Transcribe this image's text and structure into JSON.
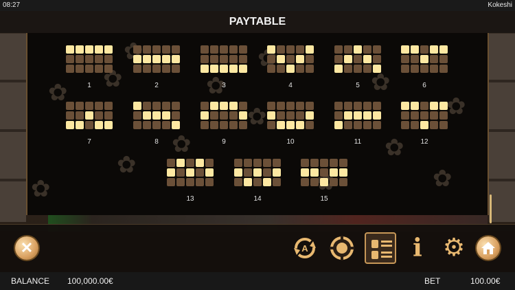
{
  "status": {
    "time": "08:27",
    "game_name": "Kokeshi"
  },
  "paytable": {
    "title": "PAYTABLE",
    "lines": [
      {
        "number": "1",
        "rows": [
          [
            1,
            1,
            1,
            1,
            1
          ],
          [
            0,
            0,
            0,
            0,
            0
          ],
          [
            0,
            0,
            0,
            0,
            0
          ]
        ]
      },
      {
        "number": "2",
        "rows": [
          [
            0,
            0,
            0,
            0,
            0
          ],
          [
            1,
            1,
            1,
            1,
            1
          ],
          [
            0,
            0,
            0,
            0,
            0
          ]
        ]
      },
      {
        "number": "3",
        "rows": [
          [
            0,
            0,
            0,
            0,
            0
          ],
          [
            0,
            0,
            0,
            0,
            0
          ],
          [
            1,
            1,
            1,
            1,
            1
          ]
        ]
      },
      {
        "number": "4",
        "rows": [
          [
            1,
            0,
            0,
            0,
            1
          ],
          [
            0,
            1,
            0,
            1,
            0
          ],
          [
            0,
            0,
            1,
            0,
            0
          ]
        ]
      },
      {
        "number": "5",
        "rows": [
          [
            0,
            0,
            1,
            0,
            0
          ],
          [
            0,
            1,
            0,
            1,
            0
          ],
          [
            1,
            0,
            0,
            0,
            1
          ]
        ]
      },
      {
        "number": "6",
        "rows": [
          [
            1,
            1,
            0,
            1,
            1
          ],
          [
            0,
            0,
            1,
            0,
            0
          ],
          [
            0,
            0,
            0,
            0,
            0
          ]
        ]
      },
      {
        "number": "7",
        "rows": [
          [
            0,
            0,
            0,
            0,
            0
          ],
          [
            0,
            0,
            1,
            0,
            0
          ],
          [
            1,
            1,
            0,
            1,
            1
          ]
        ]
      },
      {
        "number": "8",
        "rows": [
          [
            1,
            0,
            0,
            0,
            0
          ],
          [
            0,
            1,
            1,
            1,
            0
          ],
          [
            0,
            0,
            0,
            0,
            1
          ]
        ]
      },
      {
        "number": "9",
        "rows": [
          [
            0,
            1,
            1,
            1,
            0
          ],
          [
            1,
            0,
            0,
            0,
            1
          ],
          [
            0,
            0,
            0,
            0,
            0
          ]
        ]
      },
      {
        "number": "10",
        "rows": [
          [
            0,
            0,
            0,
            0,
            0
          ],
          [
            1,
            0,
            0,
            0,
            1
          ],
          [
            0,
            1,
            1,
            1,
            0
          ]
        ]
      },
      {
        "number": "11",
        "rows": [
          [
            0,
            0,
            0,
            0,
            0
          ],
          [
            0,
            1,
            1,
            1,
            1
          ],
          [
            1,
            0,
            0,
            0,
            0
          ]
        ]
      },
      {
        "number": "12",
        "rows": [
          [
            1,
            1,
            0,
            1,
            1
          ],
          [
            0,
            0,
            0,
            0,
            0
          ],
          [
            0,
            0,
            1,
            0,
            0
          ]
        ]
      },
      {
        "number": "13",
        "rows": [
          [
            0,
            1,
            0,
            1,
            0
          ],
          [
            1,
            0,
            1,
            0,
            1
          ],
          [
            0,
            0,
            0,
            0,
            0
          ]
        ]
      },
      {
        "number": "14",
        "rows": [
          [
            0,
            0,
            0,
            0,
            0
          ],
          [
            1,
            0,
            1,
            0,
            1
          ],
          [
            0,
            1,
            0,
            1,
            0
          ]
        ]
      },
      {
        "number": "15",
        "rows": [
          [
            0,
            0,
            0,
            0,
            0
          ],
          [
            1,
            1,
            0,
            1,
            1
          ],
          [
            0,
            0,
            1,
            0,
            0
          ]
        ]
      }
    ]
  },
  "toolbar": {
    "close_icon": "close-icon",
    "autoplay_icon": "autoplay-icon",
    "chip_icon": "chip-icon",
    "paytable_icon": "paytable-icon",
    "info_icon": "info-icon",
    "settings_icon": "gear-icon",
    "home_icon": "home-icon"
  },
  "footer": {
    "balance_label": "BALANCE",
    "balance_value": "100,000.00€",
    "bet_label": "BET",
    "bet_value": "100.00€"
  },
  "colors": {
    "cell_on": "#fde8a2",
    "cell_off": "#6b5038",
    "accent_gold": "#e8b870"
  }
}
